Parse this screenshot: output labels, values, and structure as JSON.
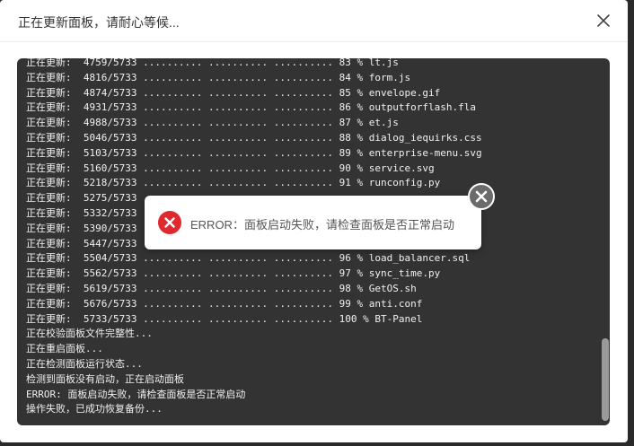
{
  "dialog": {
    "title": "正在更新面板，请耐心等候..."
  },
  "log_lines": [
    "正在更新:  4759/5733 .......... .......... .......... 83 % lt.js",
    "正在更新:  4816/5733 .......... .......... .......... 84 % form.js",
    "正在更新:  4874/5733 .......... .......... .......... 85 % envelope.gif",
    "正在更新:  4931/5733 .......... .......... .......... 86 % outputforflash.fla",
    "正在更新:  4988/5733 .......... .......... .......... 87 % et.js",
    "正在更新:  5046/5733 .......... .......... .......... 88 % dialog_iequirks.css",
    "正在更新:  5103/5733 .......... .......... .......... 89 % enterprise-menu.svg",
    "正在更新:  5160/5733 .......... .......... .......... 90 % service.svg",
    "正在更新:  5218/5733 .......... .......... .......... 91 % runconfig.py",
    "正在更新:  5275/5733",
    "正在更新:  5332/5733",
    "正在更新:  5390/5733",
    "正在更新:  5447/5733",
    "正在更新:  5504/5733 .......... .......... .......... 96 % load_balancer.sql",
    "正在更新:  5562/5733 .......... .......... .......... 97 % sync_time.py",
    "正在更新:  5619/5733 .......... .......... .......... 98 % GetOS.sh",
    "正在更新:  5676/5733 .......... .......... .......... 99 % anti.conf",
    "正在更新:  5733/5733 .......... .......... .......... 100 % BT-Panel",
    "正在校验面板文件完整性...",
    "正在重启面板...",
    "正在检测面板运行状态...",
    "检测到面板没有启动，正在启动面板",
    "ERROR: 面板启动失败，请检查面板是否正常启动",
    "操作失败，已成功恢复备份..."
  ],
  "toast": {
    "message": "ERROR：面板启动失败，请检查面板是否正常启动",
    "icon": "error-icon",
    "icon_color": "#e0292e"
  },
  "colors": {
    "console_bg": "#333333",
    "console_text": "#f0f0f0",
    "toast_close_bg": "#6b6b6b"
  }
}
